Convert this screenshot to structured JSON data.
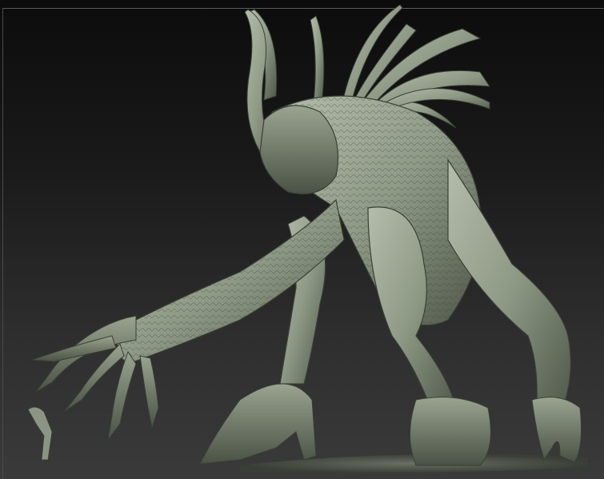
{
  "viewport": {
    "background_top": "#0c0c0c",
    "background_bottom": "#3a3a3a",
    "frame_line_color": "#5a5a5a"
  },
  "model": {
    "material_color": "#8f9a86",
    "material_shadow": "#4f5749",
    "material_highlight": "#c4ccbb",
    "ground_color": "#5d6358"
  }
}
